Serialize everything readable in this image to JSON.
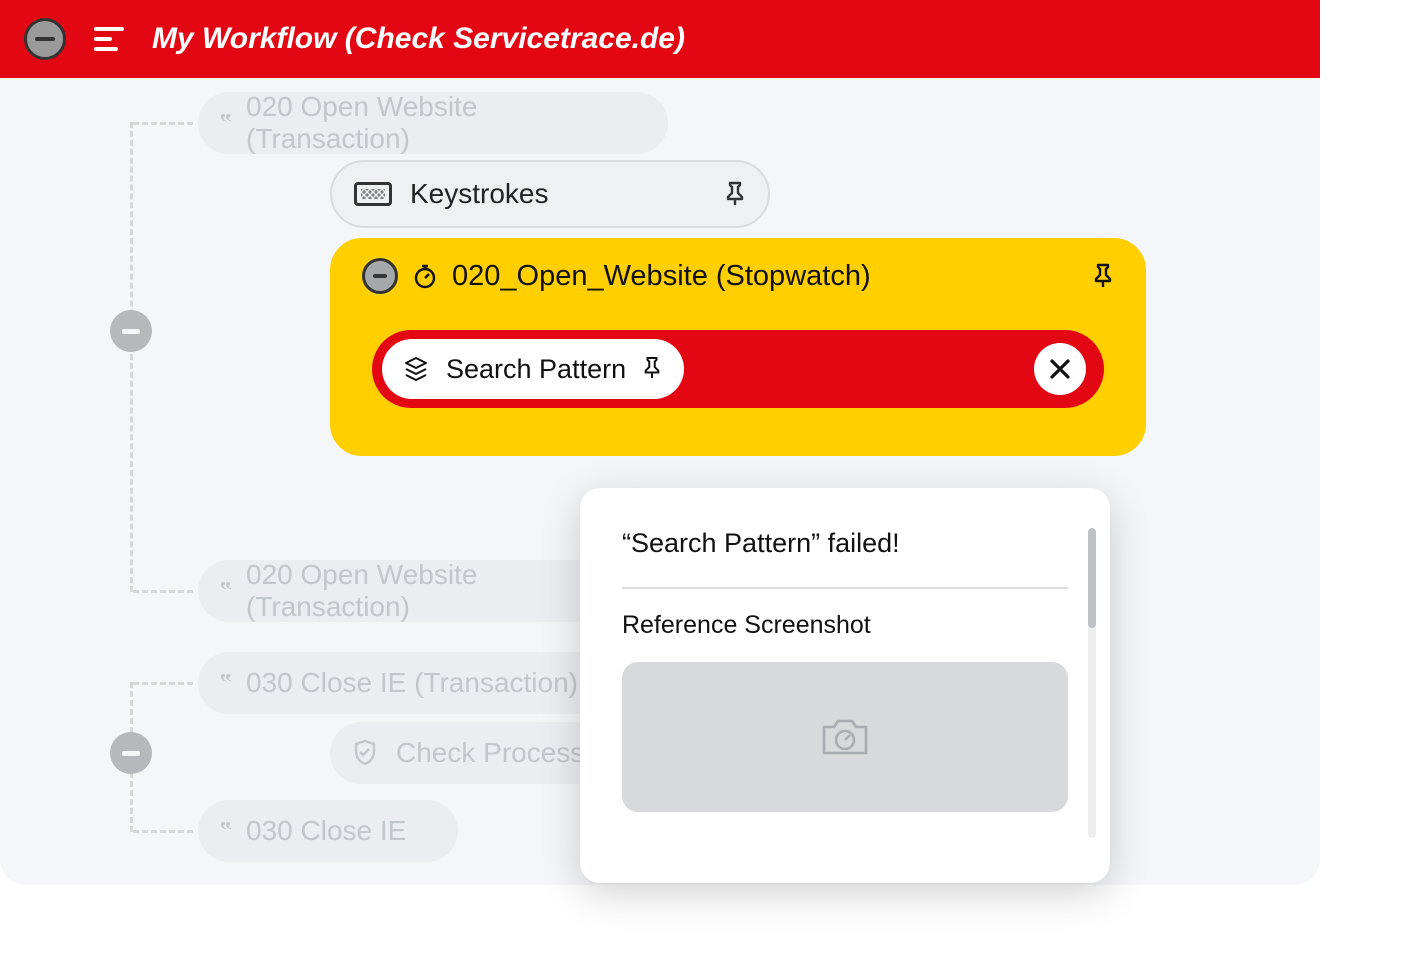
{
  "header": {
    "title": "My Workflow (Check Servicetrace.de)"
  },
  "tree": {
    "node1_label": "020 Open Website (Transaction)",
    "keystrokes_label": "Keystrokes",
    "stopwatch_label": "020_Open_Website (Stopwatch)",
    "search_pattern_label": "Search Pattern",
    "node2_label": "020 Open Website (Transaction)",
    "node3_label": "030 Close IE (Transaction)",
    "check_process_label": "Check Process",
    "node4_label": "030 Close IE"
  },
  "popup": {
    "heading": "“Search Pattern” failed!",
    "section1": "Reference Screenshot"
  }
}
